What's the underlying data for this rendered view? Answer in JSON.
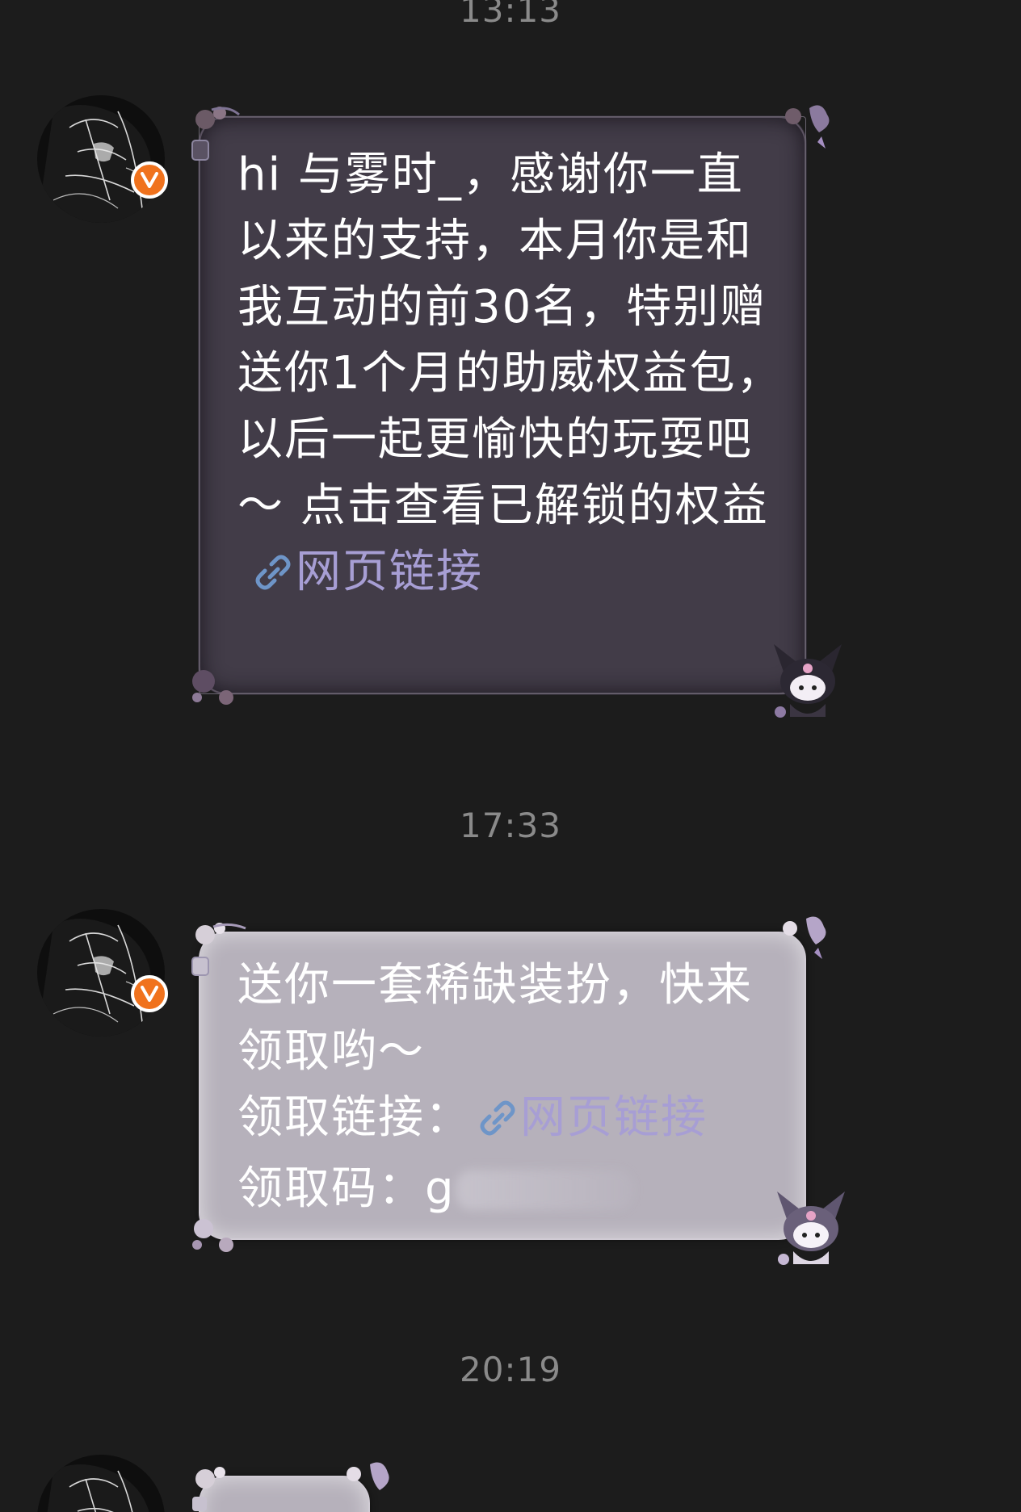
{
  "messages": [
    {
      "time": "13:13",
      "text": "hi 与雾时_，感谢你一直以来的支持，本月你是和我互动的前30名，特别赠送你1个月的助威权益包，以后一起更愉快的玩耍吧～ 点击查看已解锁的权益",
      "link_label": "网页链接",
      "style": "dark"
    },
    {
      "time": "17:33",
      "line1": "送你一套稀缺装扮，快来领取哟～",
      "line2_prefix": "领取链接：",
      "link_label": "网页链接",
      "line3_prefix": "领取码：",
      "code_partial": "g",
      "style": "light"
    },
    {
      "time": "20:19",
      "style": "light"
    }
  ],
  "badge": {
    "label": "V",
    "color": "#f0721d"
  },
  "colors": {
    "background": "#1c1c1c",
    "timestamp": "#8a8a8a",
    "link": "#a79ed4",
    "dark_bubble": "#423c48",
    "light_bubble": "#b6b1bb"
  },
  "icons": [
    "link-icon",
    "verified-badge-icon",
    "kuromi-sticker-icon",
    "flower-decoration-icon",
    "avatar-image"
  ]
}
